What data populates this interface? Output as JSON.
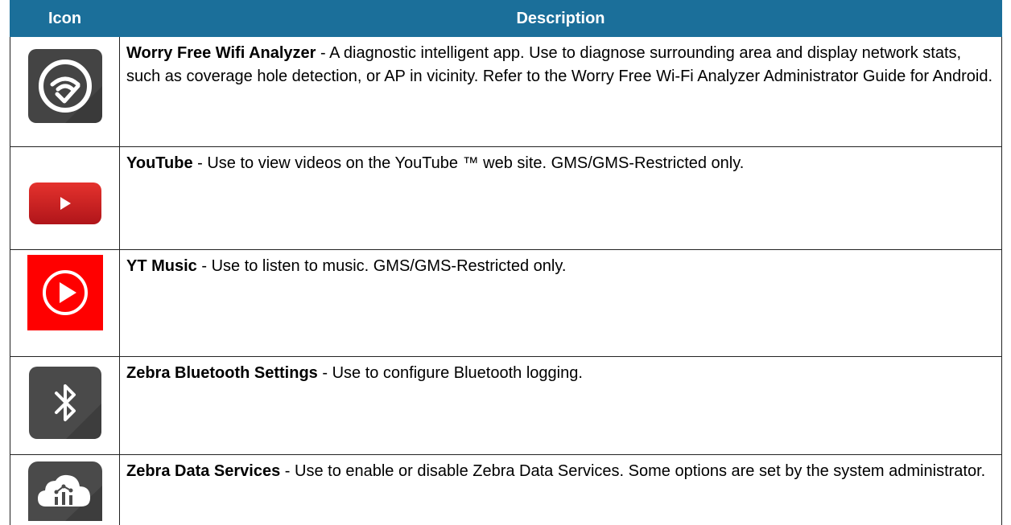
{
  "table": {
    "headers": {
      "icon": "Icon",
      "description": "Description"
    },
    "rows": [
      {
        "icon": "wifi-analyzer-icon",
        "name": "Worry Free Wifi Analyzer",
        "text": " - A diagnostic intelligent app. Use to diagnose surrounding area and display network stats, such as coverage hole detection, or AP in vicinity. Refer to the Worry Free Wi-Fi Analyzer Administrator Guide for Android."
      },
      {
        "icon": "youtube-icon",
        "name": "YouTube",
        "text": " - Use to view videos on the YouTube ™ web site. GMS/GMS-Restricted only."
      },
      {
        "icon": "yt-music-icon",
        "name": "YT Music",
        "text": " - Use to listen to music. GMS/GMS-Restricted only."
      },
      {
        "icon": "bluetooth-icon",
        "name": "Zebra Bluetooth Settings",
        "text": " - Use to configure Bluetooth logging."
      },
      {
        "icon": "cloud-data-icon",
        "name": "Zebra Data Services",
        "text": " - Use to enable or disable Zebra Data Services. Some options are set by the system administrator."
      }
    ]
  },
  "colors": {
    "header_bg": "#1b6f9a",
    "youtube_red": "#e0211e",
    "yt_music_red": "#ff0000",
    "icon_dark": "#4a4a4a"
  }
}
